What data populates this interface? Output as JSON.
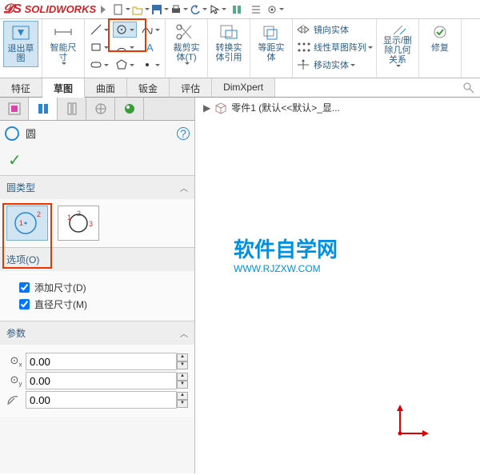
{
  "app": {
    "name": "SOLIDWORKS"
  },
  "ribbon": {
    "exit_sketch": "退出草\n图",
    "smart_dim": "智能尺\n寸",
    "trim": "裁剪实\n体(T)",
    "convert": "转换实\n体引用",
    "offset": "等距实\n体",
    "mirror": "镜向实体",
    "pattern": "线性草图阵列",
    "move": "移动实体",
    "show_hide": "显示/删\n除几何\n关系",
    "repair": "修复"
  },
  "tabs": {
    "t1": "特征",
    "t2": "草图",
    "t3": "曲面",
    "t4": "钣金",
    "t5": "评估",
    "t6": "DimXpert"
  },
  "breadcrumb": {
    "part": "零件1 (默认<<默认>_显..."
  },
  "pm": {
    "title": "圆",
    "sec_type": "圆类型",
    "sec_options": "选项(O)",
    "opt_add_dim": "添加尺寸(D)",
    "opt_diam_dim": "直径尺寸(M)",
    "sec_params": "参数",
    "cx": "0.00",
    "cy": "0.00",
    "r": "0.00"
  },
  "watermark": {
    "cn": "软件自学网",
    "url": "WWW.RJZXW.COM"
  }
}
